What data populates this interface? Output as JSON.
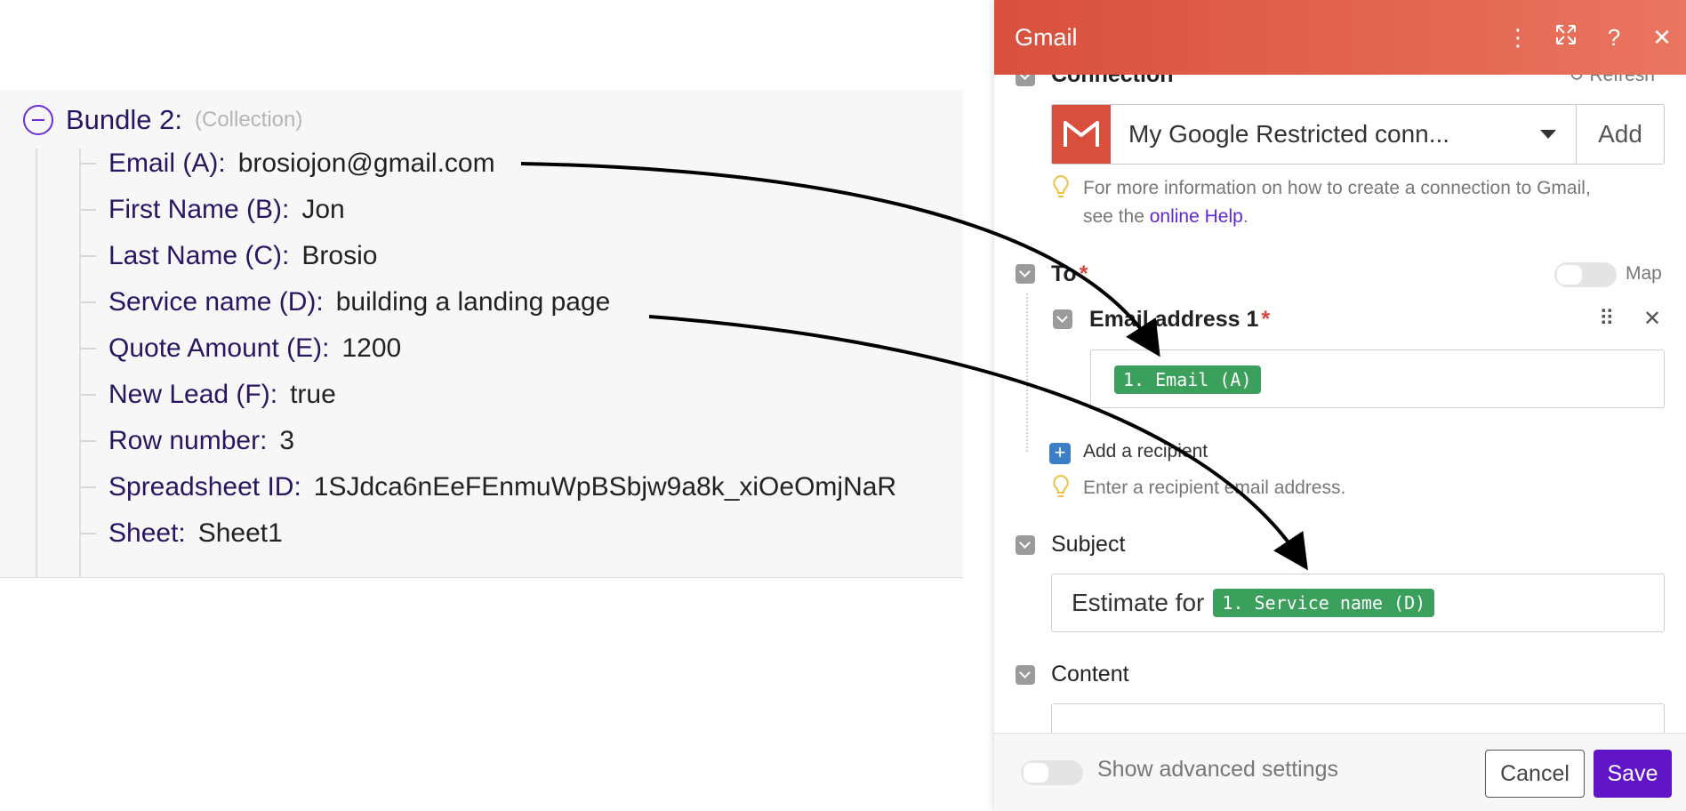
{
  "bundle": {
    "title": "Bundle 2:",
    "type": "(Collection)",
    "fields": [
      {
        "key": "Email (A):",
        "value": "brosiojon@gmail.com"
      },
      {
        "key": "First Name (B):",
        "value": "Jon"
      },
      {
        "key": "Last Name (C):",
        "value": "Brosio"
      },
      {
        "key": "Service name (D):",
        "value": "building a landing page"
      },
      {
        "key": "Quote Amount (E):",
        "value": "1200"
      },
      {
        "key": "New Lead (F):",
        "value": "true"
      },
      {
        "key": "Row number:",
        "value": "3"
      },
      {
        "key": "Spreadsheet ID:",
        "value": "1SJdca6nEeFEnmuWpBSbjw9a8k_xiOeOmjNaR"
      },
      {
        "key": "Sheet:",
        "value": "Sheet1"
      }
    ]
  },
  "module": {
    "title": "Gmail",
    "connection": {
      "label": "Connection",
      "refresh": "Refresh",
      "selected": "My Google Restricted conn...",
      "add": "Add",
      "hint_prefix": "For more information on how to create a connection to Gmail,",
      "hint_line2_prefix": "see the",
      "hint_link": "online Help",
      "hint_suffix": "."
    },
    "to": {
      "label": "To",
      "map_label": "Map",
      "email_label": "Email address 1",
      "email_pill": "1. Email (A)",
      "add_recipient": "Add a recipient",
      "hint": "Enter a recipient email address."
    },
    "subject": {
      "label": "Subject",
      "text": "Estimate for",
      "pill": "1. Service name (D)"
    },
    "content": {
      "label": "Content"
    },
    "footer": {
      "advanced": "Show advanced settings",
      "cancel": "Cancel",
      "save": "Save"
    }
  },
  "colors": {
    "header": "#d8503d",
    "accent": "#6016c7",
    "pill": "#3aa05c",
    "bundle_text": "#2a1563"
  }
}
